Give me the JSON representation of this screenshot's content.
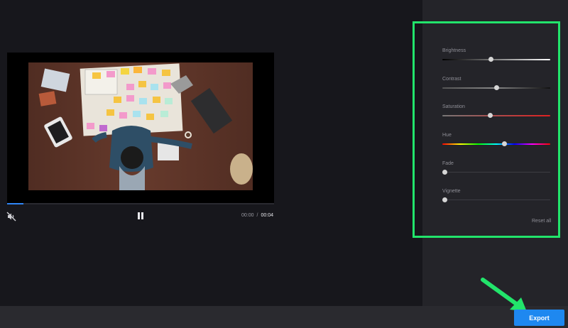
{
  "player": {
    "progress": 0.06,
    "current_time": "00:00",
    "separator": "/",
    "duration": "00:04",
    "mute_icon": "muted-speaker-icon",
    "pause_icon": "pause-icon"
  },
  "adjustments": {
    "controls": [
      {
        "label": "Brightness",
        "value": 0.45,
        "track": "brightness-gradient"
      },
      {
        "label": "Contrast",
        "value": 0.5,
        "track": "contrast-gradient"
      },
      {
        "label": "Saturation",
        "value": 0.44,
        "track": "saturation-gradient"
      },
      {
        "label": "Hue",
        "value": 0.57,
        "track": "hue-spectrum"
      },
      {
        "label": "Fade",
        "value": 0.0,
        "track": "plain"
      },
      {
        "label": "Vignette",
        "value": 0.0,
        "track": "plain"
      }
    ],
    "reset_label": "Reset all",
    "highlight_color": "#22e46b"
  },
  "export": {
    "label": "Export",
    "color": "#1e88f0"
  },
  "colors": {
    "accent": "#2f86f6",
    "highlight": "#22e46b",
    "arrow": "#22e46b"
  }
}
